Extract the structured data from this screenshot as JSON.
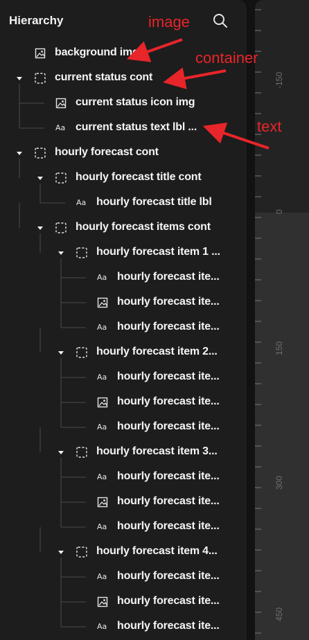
{
  "panel": {
    "title": "Hierarchy",
    "search_icon": "search-icon"
  },
  "tree": [
    {
      "label": "background img",
      "type": "image",
      "level": 0,
      "toggle": false
    },
    {
      "label": "current status cont",
      "type": "container",
      "level": 0,
      "toggle": true
    },
    {
      "label": "current status icon img",
      "type": "image",
      "level": 1,
      "toggle": false
    },
    {
      "label": "current status text lbl ...",
      "type": "text",
      "level": 1,
      "toggle": false
    },
    {
      "label": "hourly forecast cont",
      "type": "container",
      "level": 0,
      "toggle": true
    },
    {
      "label": "hourly forecast title cont",
      "type": "container",
      "level": 1,
      "toggle": true
    },
    {
      "label": "hourly forecast title lbl",
      "type": "text",
      "level": 2,
      "toggle": false
    },
    {
      "label": "hourly forecast items cont",
      "type": "container",
      "level": 1,
      "toggle": true
    },
    {
      "label": "hourly forecast item 1 ...",
      "type": "container",
      "level": 2,
      "toggle": true
    },
    {
      "label": "hourly forecast ite...",
      "type": "text",
      "level": 3,
      "toggle": false
    },
    {
      "label": "hourly forecast ite...",
      "type": "image",
      "level": 3,
      "toggle": false
    },
    {
      "label": "hourly forecast ite...",
      "type": "text",
      "level": 3,
      "toggle": false
    },
    {
      "label": "hourly forecast item 2...",
      "type": "container",
      "level": 2,
      "toggle": true
    },
    {
      "label": "hourly forecast ite...",
      "type": "text",
      "level": 3,
      "toggle": false
    },
    {
      "label": "hourly forecast ite...",
      "type": "image",
      "level": 3,
      "toggle": false
    },
    {
      "label": "hourly forecast ite...",
      "type": "text",
      "level": 3,
      "toggle": false
    },
    {
      "label": "hourly forecast item 3...",
      "type": "container",
      "level": 2,
      "toggle": true
    },
    {
      "label": "hourly forecast ite...",
      "type": "text",
      "level": 3,
      "toggle": false
    },
    {
      "label": "hourly forecast ite...",
      "type": "image",
      "level": 3,
      "toggle": false
    },
    {
      "label": "hourly forecast ite...",
      "type": "text",
      "level": 3,
      "toggle": false
    },
    {
      "label": "hourly forecast item 4...",
      "type": "container",
      "level": 2,
      "toggle": true
    },
    {
      "label": "hourly forecast ite...",
      "type": "text",
      "level": 3,
      "toggle": false
    },
    {
      "label": "hourly forecast ite...",
      "type": "image",
      "level": 3,
      "toggle": false
    },
    {
      "label": "hourly forecast ite...",
      "type": "text",
      "level": 3,
      "toggle": false
    }
  ],
  "icon_glyphs": {
    "text": "Aa"
  },
  "annotations": {
    "image": "image",
    "container": "container",
    "text": "text"
  },
  "ruler": {
    "labels": [
      "-150",
      "0",
      "150",
      "300",
      "450"
    ]
  },
  "colors": {
    "annotation": "#e8252a",
    "panel": "#1d1d1d",
    "ruler": "#232323"
  }
}
